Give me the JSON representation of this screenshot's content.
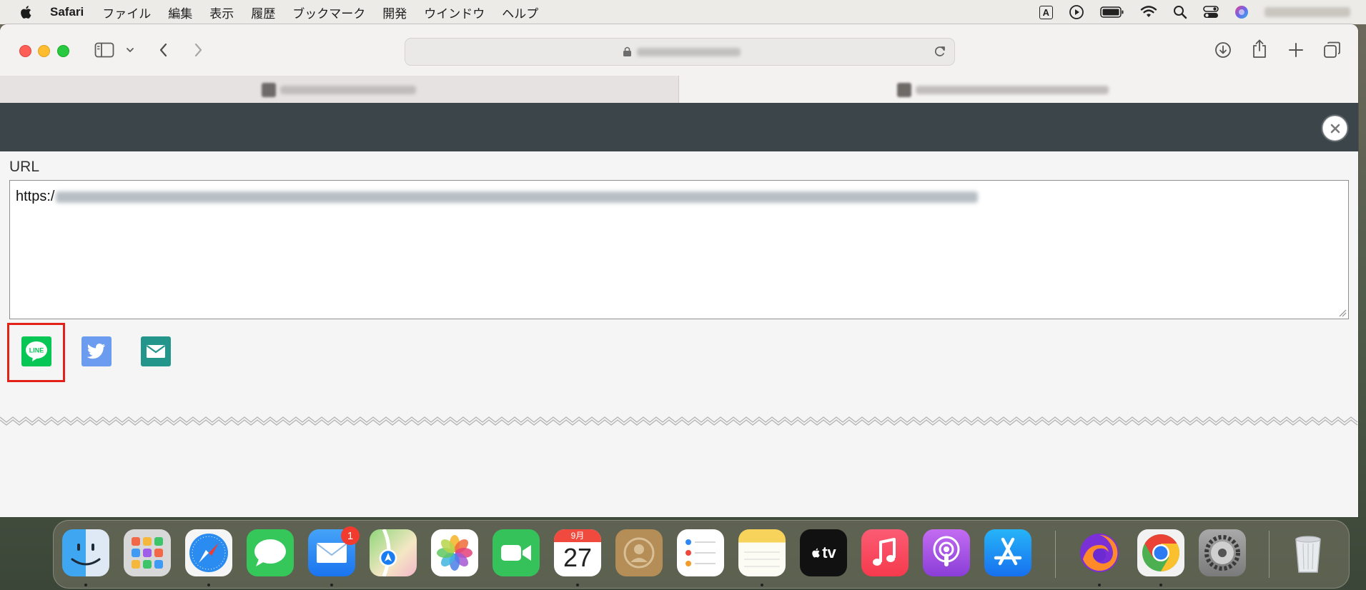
{
  "menubar": {
    "app_name": "Safari",
    "items": [
      "ファイル",
      "編集",
      "表示",
      "履歴",
      "ブックマーク",
      "開発",
      "ウインドウ",
      "ヘルプ"
    ],
    "input_indicator": "A"
  },
  "page": {
    "url_label": "URL",
    "url_prefix": "https:/"
  },
  "dock": {
    "mail_badge": "1",
    "calendar_month": "9月",
    "calendar_day": "27",
    "tv_label": "tv"
  },
  "colors": {
    "dark_header": "#3c4549",
    "line_green": "#06c755",
    "twitter_blue": "#6c9cf0",
    "mail_teal": "#23958a",
    "highlight_red": "#e32119"
  }
}
